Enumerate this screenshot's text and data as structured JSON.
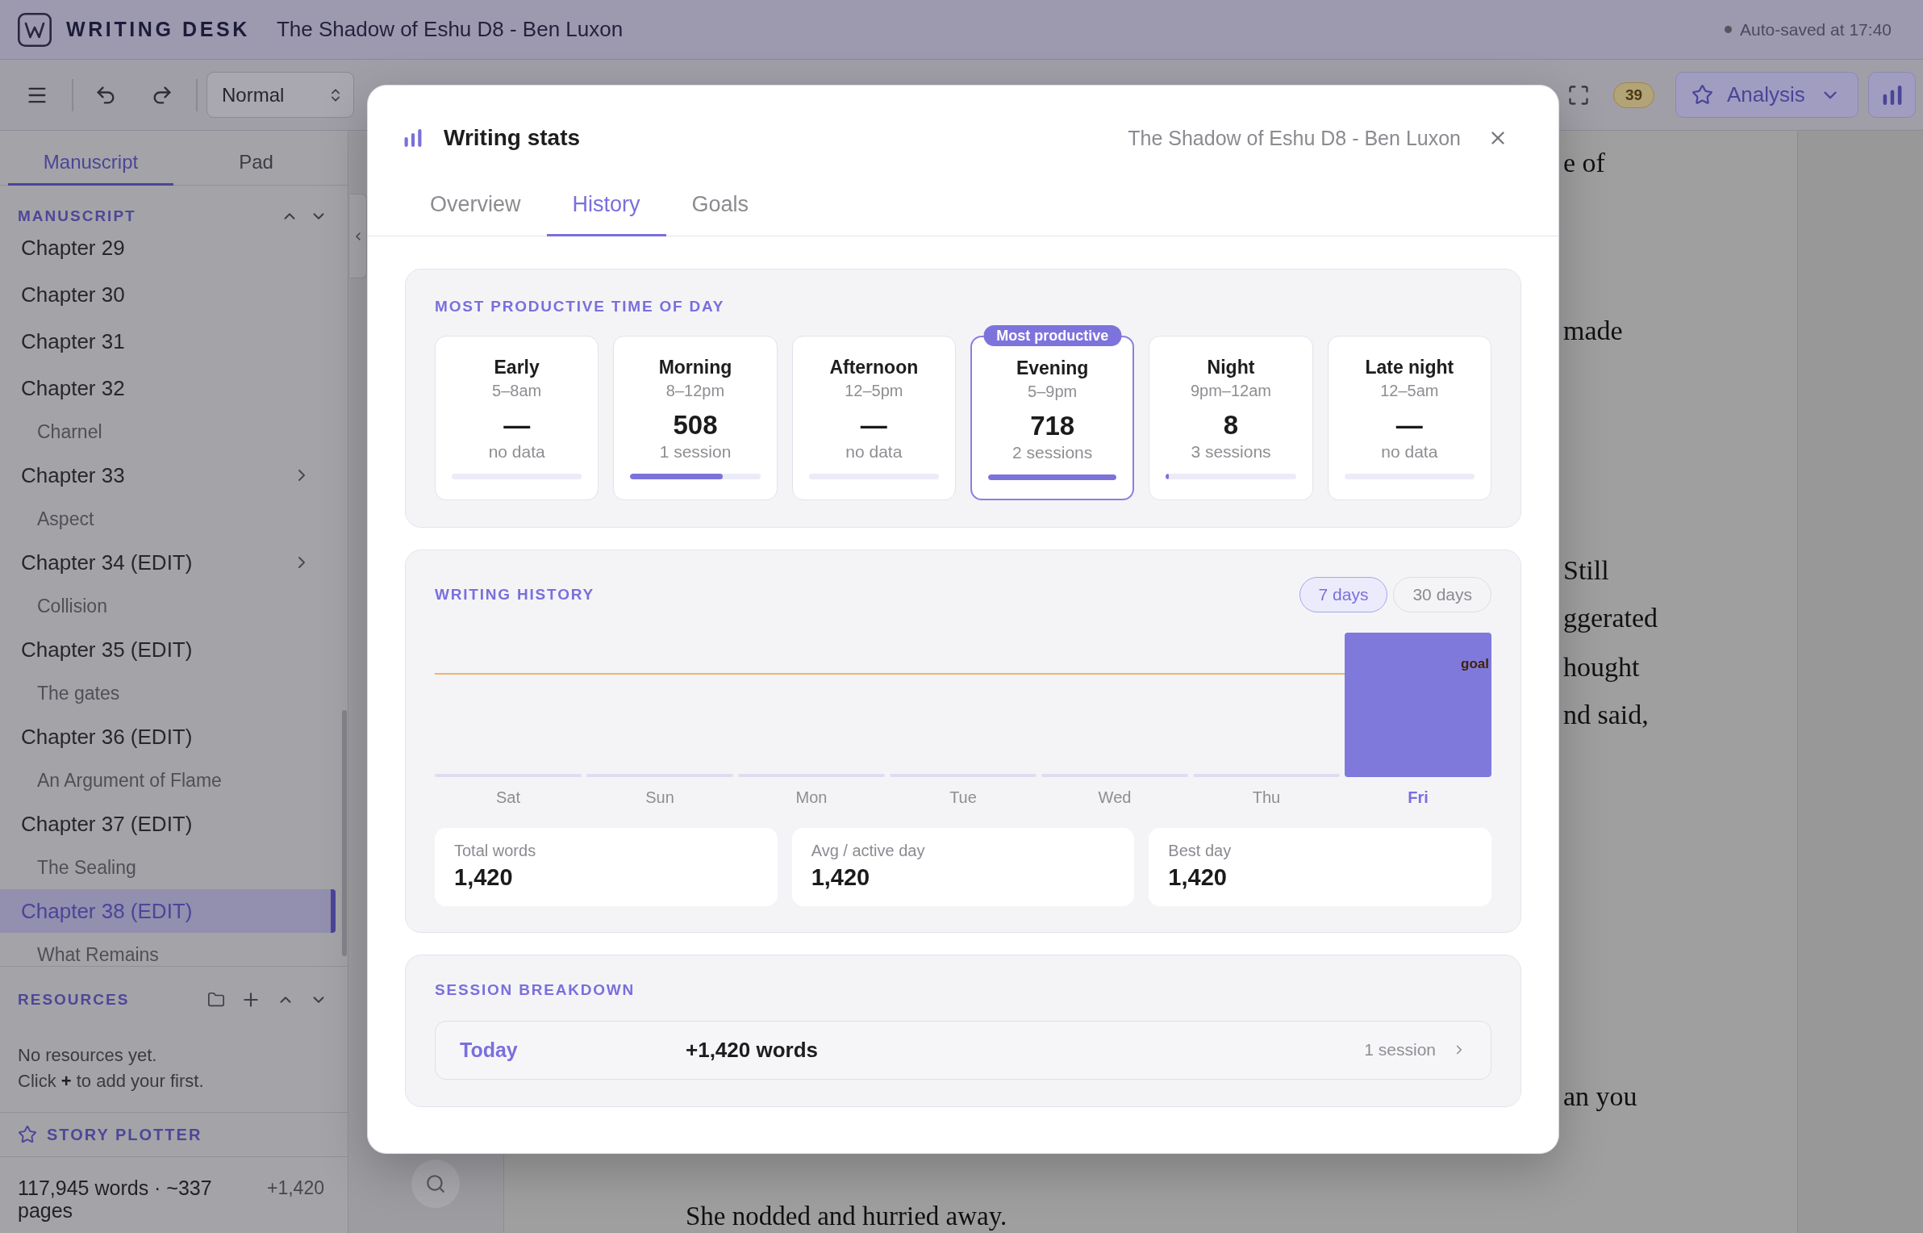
{
  "header": {
    "app_name": "WRITING DESK",
    "document_title": "The Shadow of Eshu D8 - Ben Luxon",
    "autosave": "Auto-saved at 17:40"
  },
  "toolbar": {
    "paragraph_style": "Normal",
    "count_badge": "39",
    "analysis_button": "Analysis"
  },
  "sidebar": {
    "tabs": [
      {
        "label": "Manuscript",
        "selected": true
      },
      {
        "label": "Pad",
        "selected": false
      }
    ],
    "manuscript": {
      "title": "MANUSCRIPT",
      "chapters": [
        {
          "title": "Chapter 29",
          "expandable": false,
          "selected": false
        },
        {
          "title": "Chapter 30",
          "expandable": false,
          "selected": false
        },
        {
          "title": "Chapter 31",
          "expandable": false,
          "selected": false
        },
        {
          "title": "Chapter 32",
          "subtitle": "Charnel",
          "expandable": false,
          "selected": false
        },
        {
          "title": "Chapter 33",
          "subtitle": "Aspect",
          "expandable": true,
          "selected": false
        },
        {
          "title": "Chapter 34 (EDIT)",
          "subtitle": "Collision",
          "expandable": true,
          "selected": false
        },
        {
          "title": "Chapter 35 (EDIT)",
          "subtitle": "The gates",
          "expandable": false,
          "selected": false
        },
        {
          "title": "Chapter 36 (EDIT)",
          "subtitle": "An Argument of Flame",
          "expandable": false,
          "selected": false
        },
        {
          "title": "Chapter 37 (EDIT)",
          "subtitle": "The Sealing",
          "expandable": false,
          "selected": false
        },
        {
          "title": "Chapter 38 (EDIT)",
          "subtitle": "What Remains",
          "expandable": false,
          "selected": true
        }
      ]
    },
    "resources": {
      "title": "RESOURCES",
      "empty_text": "No resources yet.",
      "hint": "Click **+** to add your first."
    },
    "story_plotter": "STORY PLOTTER",
    "footer": {
      "word_count": "117,945 words · ~337 pages",
      "session_delta": "+1,420"
    }
  },
  "editor": {
    "line_fragments": [
      "e of",
      "made",
      "Still",
      "ggerated",
      "hought",
      "nd said,",
      "an you"
    ],
    "paragraph": "She nodded and hurried away."
  },
  "dialog": {
    "title": "Writing stats",
    "document_title": "The Shadow of Eshu D8 - Ben Luxon",
    "tabs": [
      {
        "label": "Overview",
        "selected": false
      },
      {
        "label": "History",
        "selected": true
      },
      {
        "label": "Goals",
        "selected": false
      }
    ],
    "time_of_day": {
      "title": "MOST PRODUCTIVE TIME OF DAY",
      "best_badge": "Most productive",
      "slots": [
        {
          "name": "Early",
          "range": "5–8am",
          "value": "—",
          "note": "no data",
          "level": 0,
          "best": false
        },
        {
          "name": "Morning",
          "range": "8–12pm",
          "value": "508",
          "note": "1 session",
          "level": 0.71,
          "best": false
        },
        {
          "name": "Afternoon",
          "range": "12–5pm",
          "value": "—",
          "note": "no data",
          "level": 0,
          "best": false
        },
        {
          "name": "Evening",
          "range": "5–9pm",
          "value": "718",
          "note": "2 sessions",
          "level": 1,
          "best": true
        },
        {
          "name": "Night",
          "range": "9pm–12am",
          "value": "8",
          "note": "3 sessions",
          "level": 0.02,
          "best": false
        },
        {
          "name": "Late night",
          "range": "12–5am",
          "value": "—",
          "note": "no data",
          "level": 0,
          "best": false
        }
      ]
    },
    "history": {
      "title": "WRITING HISTORY",
      "ranges": [
        {
          "label": "7 days",
          "selected": true
        },
        {
          "label": "30 days",
          "selected": false
        }
      ],
      "goal_label": "goal",
      "days": [
        {
          "label": "Sat",
          "kind": "empty",
          "today": false
        },
        {
          "label": "Sun",
          "kind": "empty",
          "today": false
        },
        {
          "label": "Mon",
          "kind": "empty",
          "today": false
        },
        {
          "label": "Tue",
          "kind": "empty",
          "today": false
        },
        {
          "label": "Wed",
          "kind": "empty",
          "today": false
        },
        {
          "label": "Thu",
          "kind": "empty",
          "today": false
        },
        {
          "label": "Fri",
          "kind": "filled",
          "today": true
        }
      ],
      "stats": [
        {
          "label": "Total words",
          "value": "1,420"
        },
        {
          "label": "Avg / active day",
          "value": "1,420"
        },
        {
          "label": "Best day",
          "value": "1,420"
        }
      ]
    },
    "sessions": {
      "title": "SESSION BREAKDOWN",
      "rows": [
        {
          "day": "Today",
          "words": "+1,420 words",
          "count": "1 session"
        }
      ]
    }
  }
}
